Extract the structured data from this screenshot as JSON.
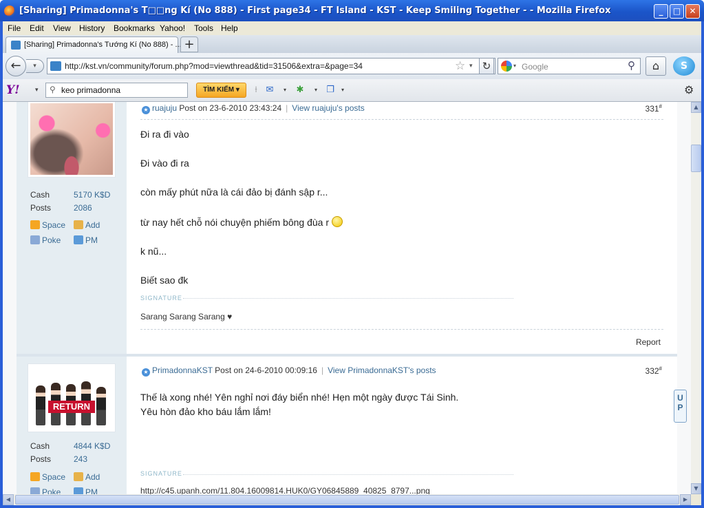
{
  "window": {
    "title": "[Sharing] Primadonna's T□□ng Kí (No 888) - First page34 - FT Island - KST - Keep Smiling Together - - Mozilla Firefox",
    "minimize": "_",
    "maximize": "□",
    "close": "✕"
  },
  "menu": [
    "File",
    "Edit",
    "View",
    "History",
    "Bookmarks",
    "Yahoo!",
    "Tools",
    "Help"
  ],
  "tab": {
    "title": "[Sharing] Primadonna's Tướng Kí (No 888) - ...",
    "new_tab": "+"
  },
  "nav": {
    "back": "←",
    "forward": "▾",
    "url": "http://kst.vn/community/forum.php?mod=viewthread&tid=31506&extra=&page=34",
    "reload": "↻",
    "search_placeholder": "Google",
    "home": "⌂",
    "skype": "S"
  },
  "yahoo": {
    "logo": "Y!",
    "search_value": "keo primadonna",
    "search_button": "TÌM KIẾM ▾"
  },
  "posts": [
    {
      "author": "ruajuju",
      "posted": "Post on 23-6-2010 23:43:24",
      "view_posts": "View ruajuju's posts",
      "number": "331",
      "cash_label": "Cash",
      "cash_value": "5170 K$D",
      "posts_label": "Posts",
      "posts_value": "2086",
      "links": [
        "Space",
        "Add",
        "Poke",
        "PM"
      ],
      "lines": [
        "Đi ra đi vào",
        "Đi vào đi ra",
        "còn mấy phút nữa là cái đảo bị đánh sập r...",
        "từ nay hết chỗ nói chuyện phiếm bông đùa r",
        "k nũ...",
        "Biết sao đk"
      ],
      "signature_label": "SIGNATURE",
      "signature": "Sarang Sarang Sarang ♥",
      "report": "Report"
    },
    {
      "author": "PrimadonnaKST",
      "posted": "Post on 24-6-2010 00:09:16",
      "view_posts": "View PrimadonnaKST's posts",
      "number": "332",
      "cash_label": "Cash",
      "cash_value": "4844 K$D",
      "posts_label": "Posts",
      "posts_value": "243",
      "links": [
        "Space",
        "Add",
        "Poke",
        "PM"
      ],
      "avatar_text": "RETURN",
      "lines": [
        "Thế là xong nhé! Yên nghỉ nơi đáy biển nhé! Hẹn một ngày được Tái Sinh.",
        "Yêu hòn đảo kho báu lắm lắm!"
      ],
      "signature_label": "SIGNATURE",
      "signature": "http://c45.upanh.com/11.804.16009814.HUK0/GY06845889_40825_8797...png"
    }
  ],
  "up_button": "U P"
}
